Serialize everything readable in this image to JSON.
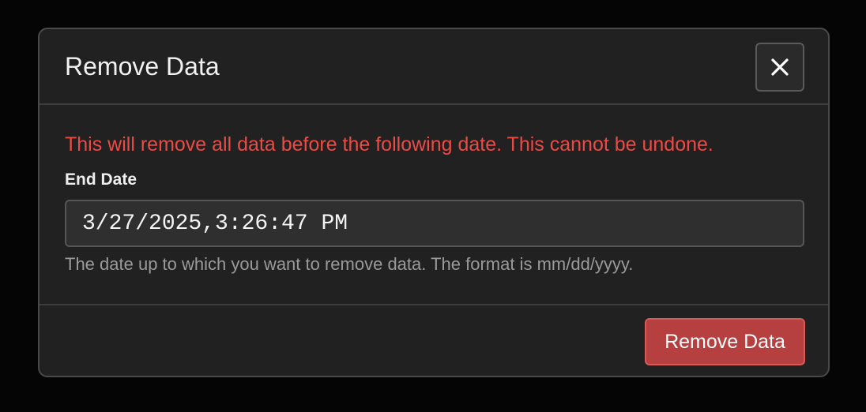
{
  "modal": {
    "title": "Remove Data",
    "close_icon": "close-icon"
  },
  "body": {
    "warning": "This will remove all data before the following date. This cannot be undone.",
    "end_date_label": "End Date",
    "end_date_value": "3/27/2025,3:26:47 PM",
    "help_text": "The date up to which you want to remove data. The format is mm/dd/yyyy."
  },
  "footer": {
    "remove_label": "Remove Data"
  },
  "colors": {
    "warning": "#ec4b45",
    "danger_button": "#b63f3f",
    "modal_bg": "#212121"
  }
}
